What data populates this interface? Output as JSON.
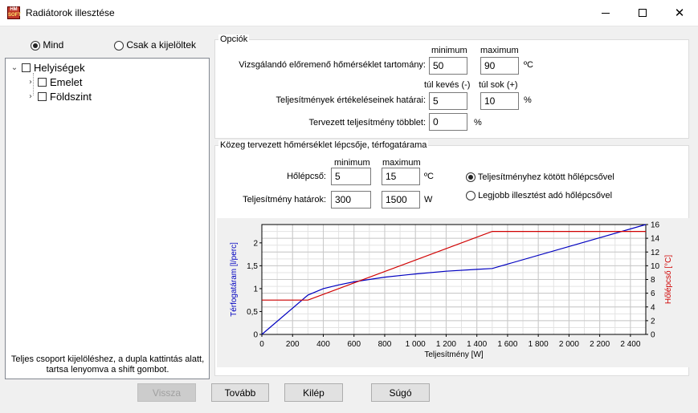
{
  "window": {
    "title": "Radiátorok illesztése",
    "icon_top": "HM",
    "icon_bottom": "SOFT",
    "minimize": "minimize",
    "maximize": "maximize",
    "close": "✕"
  },
  "left": {
    "filter_all": "Mind",
    "filter_selected": "Csak a kijelöltek",
    "tree": {
      "root": "Helyiségek",
      "children": [
        "Emelet",
        "Földszint"
      ]
    },
    "help_line1": "Teljes csoport kijelöléshez, a dupla kattintás alatt,",
    "help_line2": "tartsa lenyomva a shift gombot."
  },
  "options": {
    "title": "Opciók",
    "col_min": "minimum",
    "col_max": "maximum",
    "temp_label": "Vizsgálandó előremenő hőmérséklet tartomány:",
    "temp_min": "50",
    "temp_max": "90",
    "temp_unit": "ºC",
    "col_low": "túl kevés (-)",
    "col_high": "túl sok (+)",
    "perf_label": "Teljesítmények értékeléseinek határai:",
    "perf_low": "5",
    "perf_high": "10",
    "perf_unit": "%",
    "surplus_label": "Tervezett teljesítmény többlet:",
    "surplus_value": "0",
    "surplus_unit": "%"
  },
  "medium": {
    "title": "Közeg tervezett hőmérséklet lépcsője, térfogatárama",
    "col_min": "minimum",
    "col_max": "maximum",
    "step_label": "Hőlépcső:",
    "step_min": "5",
    "step_max": "15",
    "step_unit": "ºC",
    "power_label": "Teljesítmény határok:",
    "power_min": "300",
    "power_max": "1500",
    "power_unit": "W",
    "radio_linked": "Teljesítményhez kötött hőlépcsővel",
    "radio_best": "Legjobb illesztést adó hőlépcsővel"
  },
  "chart_data": {
    "type": "line",
    "xlabel": "Teljesítmény [W]",
    "ylabel": "Térfogatáram [l/perc]",
    "y2label": "Hőlépcső [°C]",
    "xlim": [
      0,
      2500
    ],
    "ylim": [
      0,
      2.4
    ],
    "y2lim": [
      0,
      16
    ],
    "x_ticks": [
      "0",
      "200",
      "400",
      "600",
      "800",
      "1 000",
      "1 200",
      "1 400",
      "1 600",
      "1 800",
      "2 000",
      "2 200",
      "2 400"
    ],
    "x_tick_values": [
      0,
      200,
      400,
      600,
      800,
      1000,
      1200,
      1400,
      1600,
      1800,
      2000,
      2200,
      2400
    ],
    "y_ticks": [
      "0",
      "0,5",
      "1",
      "1,5",
      "2"
    ],
    "y_tick_values": [
      0,
      0.5,
      1,
      1.5,
      2
    ],
    "y2_ticks": [
      "0",
      "2",
      "4",
      "6",
      "8",
      "10",
      "12",
      "14",
      "16"
    ],
    "y2_tick_values": [
      0,
      2,
      4,
      6,
      8,
      10,
      12,
      14,
      16
    ],
    "grid": true,
    "series": [
      {
        "axis": "left",
        "color": "#0000c0",
        "x": [
          0,
          300,
          400,
          500,
          600,
          700,
          800,
          1000,
          1200,
          1400,
          1500,
          2500
        ],
        "y": [
          0,
          0.86,
          1.0,
          1.08,
          1.15,
          1.2,
          1.25,
          1.32,
          1.38,
          1.42,
          1.44,
          2.4
        ]
      },
      {
        "axis": "right",
        "color": "#d00000",
        "x": [
          0,
          300,
          1500,
          2500
        ],
        "y": [
          5,
          5,
          15,
          15
        ]
      }
    ]
  },
  "buttons": {
    "back": "Vissza",
    "next": "Tovább",
    "exit": "Kilép",
    "help": "Súgó"
  }
}
